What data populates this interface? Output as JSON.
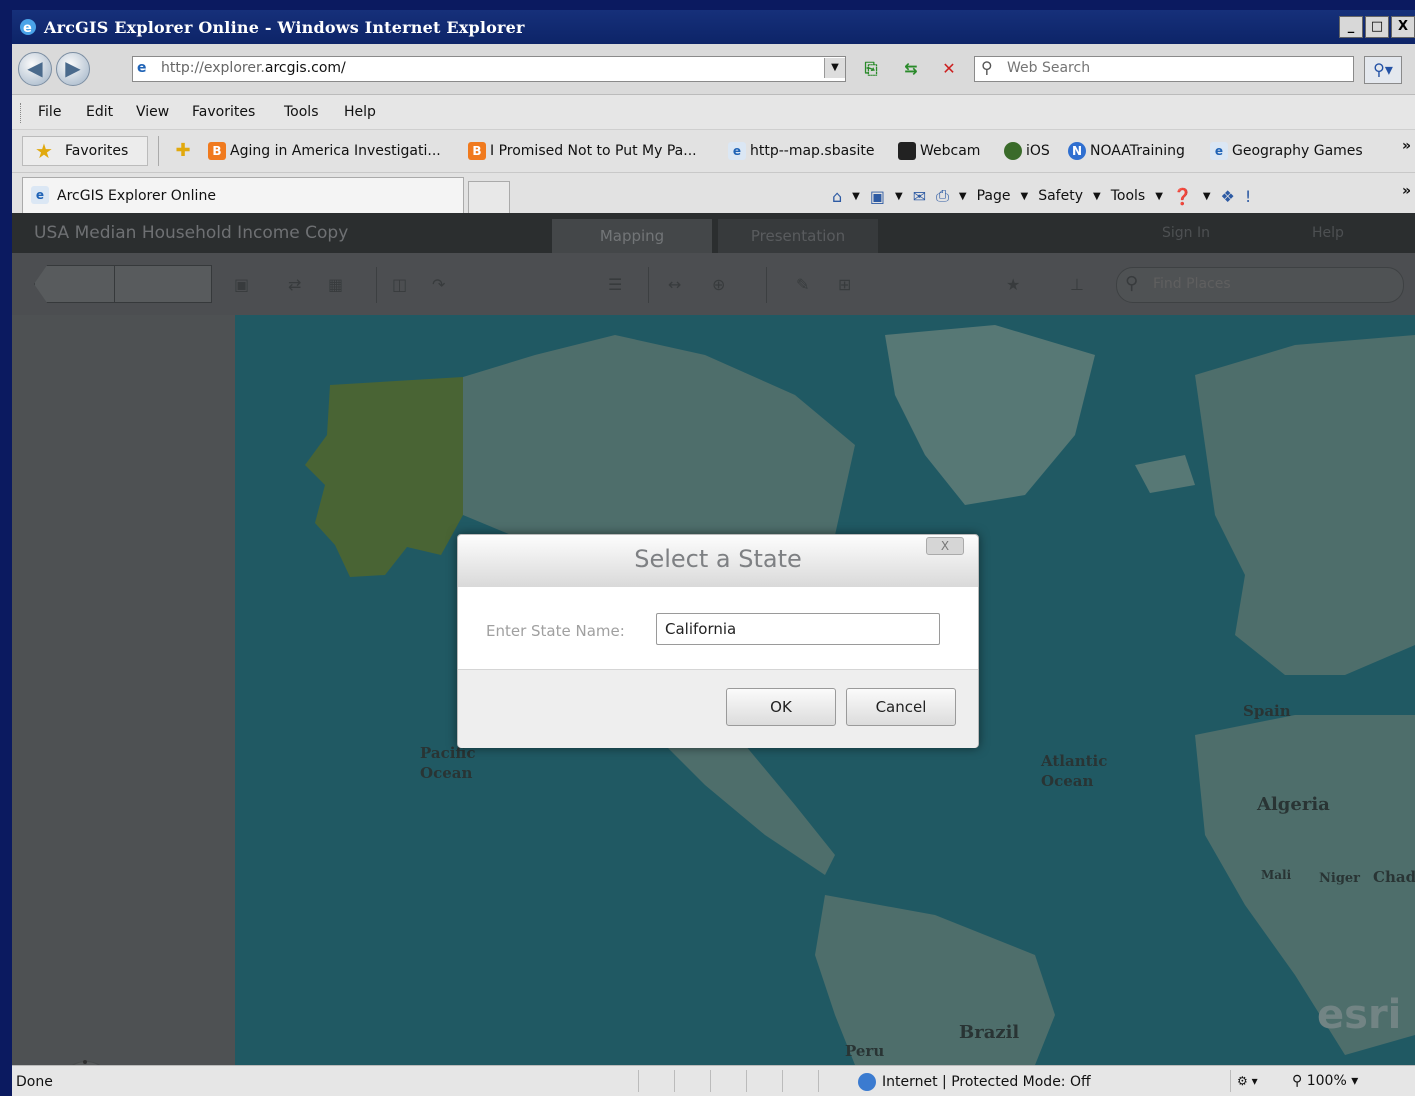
{
  "window": {
    "title": "ArcGIS Explorer Online - Windows Internet Explorer",
    "buttons": [
      "_",
      "□",
      "X"
    ]
  },
  "address": {
    "url_prefix": "http://explorer.",
    "url_domain": "arcgis.com/",
    "search_placeholder": "Web Search"
  },
  "menu": [
    "File",
    "Edit",
    "View",
    "Favorites",
    "Tools",
    "Help"
  ],
  "favorites": {
    "button_label": "Favorites",
    "items": [
      {
        "label": "Aging in America Investigati...",
        "icon": "blogger-icon"
      },
      {
        "label": "I Promised Not to Put My Pa...",
        "icon": "blogger-icon"
      },
      {
        "label": "http--map.sbasite",
        "icon": "ie-page-icon"
      },
      {
        "label": "Webcam",
        "icon": "webcam-icon"
      },
      {
        "label": "iOS",
        "icon": "ios-icon"
      },
      {
        "label": "NOAATraining",
        "icon": "noaa-icon"
      },
      {
        "label": "Geography Games",
        "icon": "ie-page-icon"
      }
    ],
    "more": "»"
  },
  "tabs": {
    "active": "ArcGIS Explorer Online",
    "commands": [
      "Page",
      "Safety",
      "Tools"
    ],
    "more": "»"
  },
  "app": {
    "title": "USA Median Household Income Copy",
    "tab_mapping": "Mapping",
    "tab_presentation": "Presentation",
    "signin": "Sign In",
    "help": "Help",
    "find_placeholder": "Find Places"
  },
  "map": {
    "labels": {
      "pacific": "Pacific\nOcean",
      "atlantic": "Atlantic\nOcean",
      "spain": "Spain",
      "algeria": "Algeria",
      "mali": "Mali",
      "niger": "Niger",
      "chad": "Chad",
      "brazil": "Brazil",
      "peru": "Peru"
    },
    "logo": "esri",
    "colors": {
      "ocean": "#1e6d7b",
      "land": "#5a8a86",
      "highlight": "#5c8a3c"
    }
  },
  "dialog": {
    "title": "Select a State",
    "field_label": "Enter State Name:",
    "field_value": "California",
    "ok": "OK",
    "cancel": "Cancel",
    "close": "X"
  },
  "status": {
    "left": "Done",
    "zone": "Internet | Protected Mode: Off",
    "zoom": "100%"
  }
}
